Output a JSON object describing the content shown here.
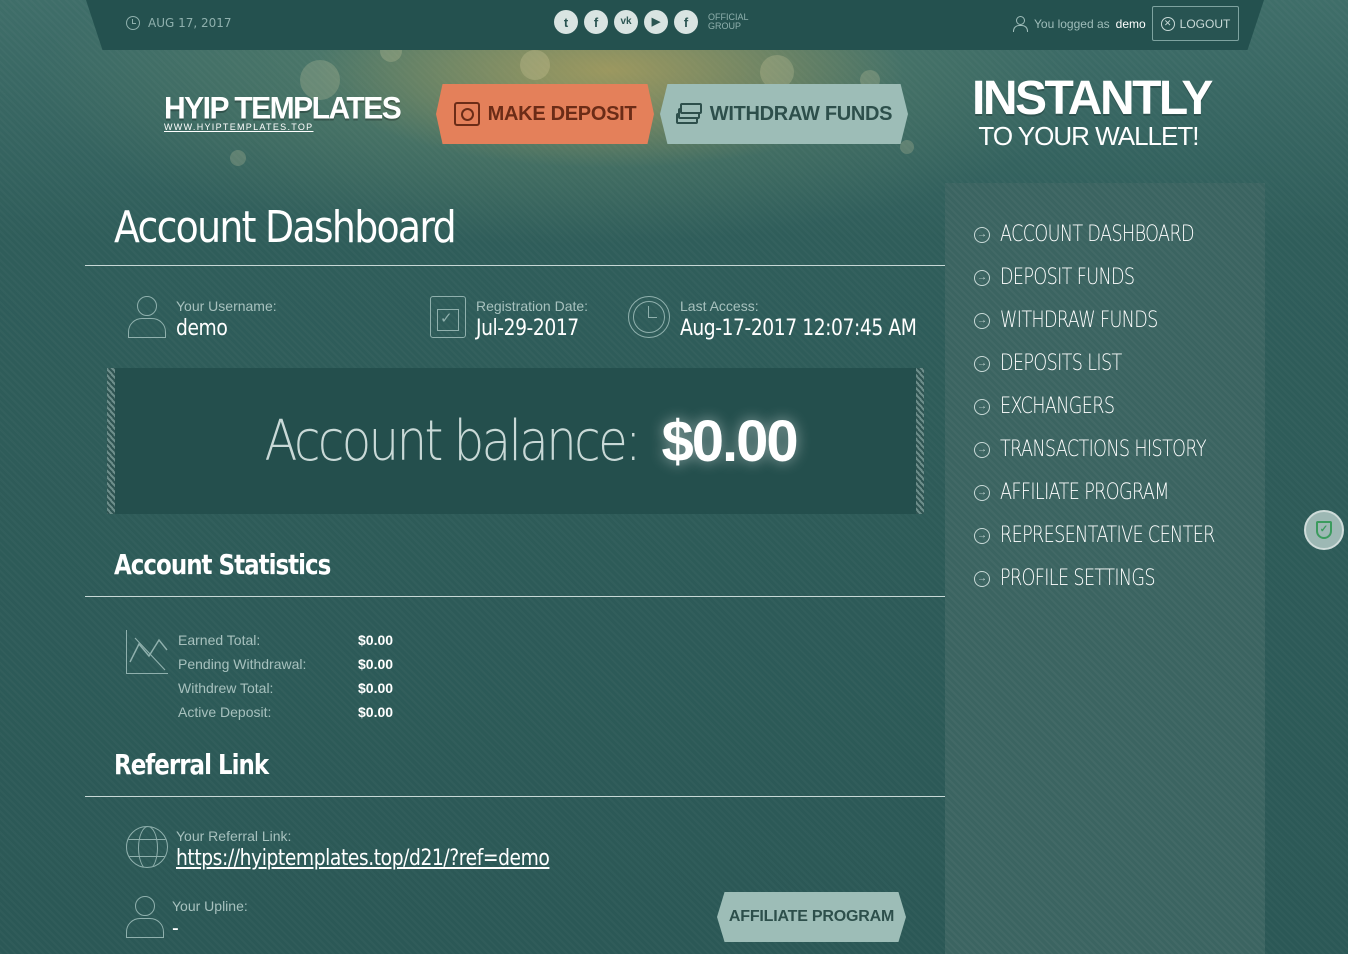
{
  "topbar": {
    "date": "AUG 17, 2017",
    "social_icons": [
      {
        "name": "twitter-icon",
        "glyph": "t"
      },
      {
        "name": "facebook-icon",
        "glyph": "f"
      },
      {
        "name": "vk-icon",
        "glyph": "vk"
      },
      {
        "name": "youtube-icon",
        "glyph": "▶"
      },
      {
        "name": "facebook-group-icon",
        "glyph": "f"
      }
    ],
    "official_group_line1": "OFFICIAL",
    "official_group_line2": "GROUP",
    "logged_prefix": "You logged as",
    "username": "demo",
    "logout_label": "LOGOUT"
  },
  "header": {
    "logo_main": "HYIP TEMPLATES",
    "logo_sub": "WWW.HYIPTEMPLATES.TOP",
    "make_deposit_label": "MAKE DEPOSIT",
    "withdraw_funds_label": "WITHDRAW FUNDS",
    "promo_line1": "INSTANTLY",
    "promo_line2": "TO YOUR WALLET!"
  },
  "main": {
    "page_title": "Account Dashboard",
    "username_label": "Your Username:",
    "username_value": "demo",
    "registration_label": "Registration Date:",
    "registration_value": "Jul-29-2017",
    "last_access_label": "Last Access:",
    "last_access_value": "Aug-17-2017 12:07:45 AM",
    "balance_label": "Account balance:",
    "balance_value": "$0.00",
    "statistics_title": "Account Statistics",
    "stats": [
      {
        "label": "Earned Total:",
        "value": "$0.00"
      },
      {
        "label": "Pending Withdrawal:",
        "value": "$0.00"
      },
      {
        "label": "Withdrew Total:",
        "value": "$0.00"
      },
      {
        "label": "Active Deposit:",
        "value": "$0.00"
      }
    ],
    "referral_title": "Referral Link",
    "referral_link_label": "Your Referral Link:",
    "referral_link_value": "https://hyiptemplates.top/d21/?ref=demo",
    "upline_label": "Your Upline:",
    "upline_value": "-",
    "affiliate_button_label": "AFFILIATE PROGRAM"
  },
  "sidebar": {
    "items": [
      {
        "label": "ACCOUNT DASHBOARD"
      },
      {
        "label": "DEPOSIT FUNDS"
      },
      {
        "label": "WITHDRAW FUNDS"
      },
      {
        "label": "DEPOSITS LIST"
      },
      {
        "label": "EXCHANGERS"
      },
      {
        "label": "TRANSACTIONS HISTORY"
      },
      {
        "label": "AFFILIATE PROGRAM"
      },
      {
        "label": "REPRESENTATIVE CENTER"
      },
      {
        "label": "PROFILE SETTINGS"
      }
    ]
  },
  "colors": {
    "background": "#2e5a58",
    "topbar": "#24514f",
    "deposit_button": "#e4805a",
    "withdraw_button": "#9dbdb7",
    "sidebar": "#3b6461"
  }
}
